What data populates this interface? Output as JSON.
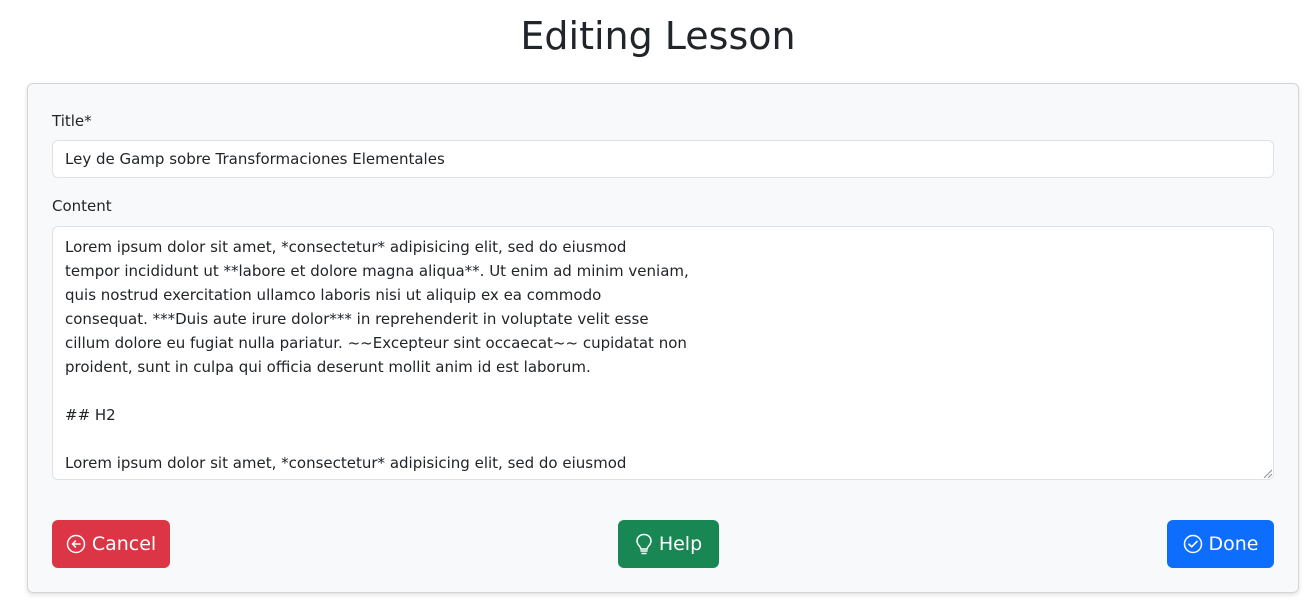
{
  "page": {
    "title": "Editing Lesson"
  },
  "form": {
    "title_label": "Title*",
    "title_value": "Ley de Gamp sobre Transformaciones Elementales",
    "content_label": "Content",
    "content_value": "Lorem ipsum dolor sit amet, *consectetur* adipisicing elit, sed do eiusmod\ntempor incididunt ut **labore et dolore magna aliqua**. Ut enim ad minim veniam,\nquis nostrud exercitation ullamco laboris nisi ut aliquip ex ea commodo\nconsequat. ***Duis aute irure dolor*** in reprehenderit in voluptate velit esse\ncillum dolore eu fugiat nulla pariatur. ~~Excepteur sint occaecat~~ cupidatat non\nproident, sunt in culpa qui officia deserunt mollit anim id est laborum.\n\n## H2\n\nLorem ipsum dolor sit amet, *consectetur* adipisicing elit, sed do eiusmod"
  },
  "actions": {
    "cancel_label": "Cancel",
    "cancel_icon": "arrow-left-circle-icon",
    "help_label": "Help",
    "help_icon": "lightbulb-icon",
    "done_label": "Done",
    "done_icon": "check-circle-icon"
  },
  "colors": {
    "cancel": "#dc3545",
    "help": "#198754",
    "done": "#0d6efd",
    "card_background": "#f8f9fa"
  }
}
